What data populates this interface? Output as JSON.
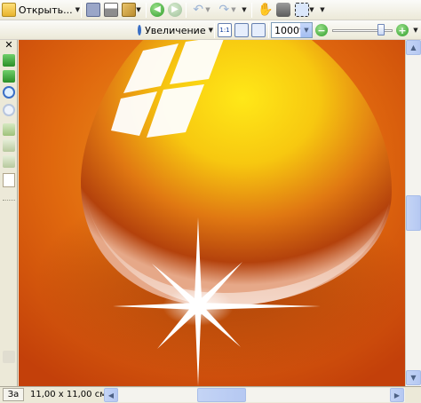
{
  "toolbar_top": {
    "open_label": "Открыть...",
    "icons": [
      "open-folder-icon",
      "save-icon",
      "print-icon",
      "export-icon",
      "back-icon",
      "forward-icon",
      "undo-icon",
      "redo-icon",
      "hand-icon",
      "camera-icon",
      "select-icon"
    ]
  },
  "toolbar_zoom": {
    "zoom_label": "Увеличение",
    "zoom_value": "1000%",
    "slider_fraction": 0.85
  },
  "left_panel": {
    "close_label": "✕",
    "tab_label": "За"
  },
  "status": {
    "size_text": "11,00 x 11,00 см"
  },
  "colors": {
    "canvas_bg": "#e07010",
    "accent_blue": "#3166c9"
  }
}
